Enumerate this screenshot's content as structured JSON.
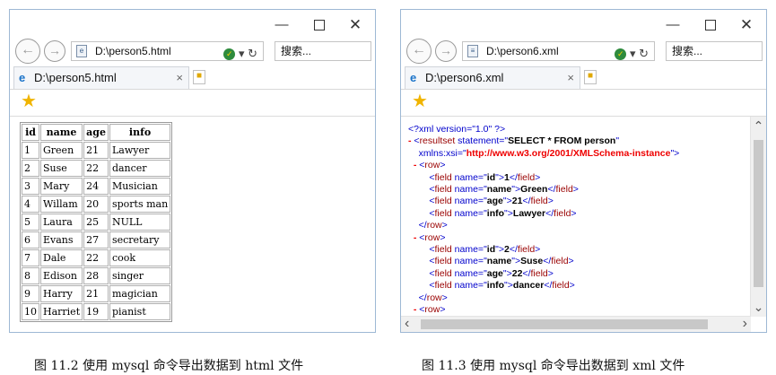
{
  "window1": {
    "address": "D:\\person5.html",
    "search": "搜索...",
    "tab_title": "D:\\person5.html",
    "table": {
      "headers": [
        "id",
        "name",
        "age",
        "info"
      ],
      "rows": [
        [
          "1",
          "Green",
          "21",
          "Lawyer"
        ],
        [
          "2",
          "Suse",
          "22",
          "dancer"
        ],
        [
          "3",
          "Mary",
          "24",
          "Musician"
        ],
        [
          "4",
          "Willam",
          "20",
          "sports man"
        ],
        [
          "5",
          "Laura",
          "25",
          "NULL"
        ],
        [
          "6",
          "Evans",
          "27",
          "secretary"
        ],
        [
          "7",
          "Dale",
          "22",
          "cook"
        ],
        [
          "8",
          "Edison",
          "28",
          "singer"
        ],
        [
          "9",
          "Harry",
          "21",
          "magician"
        ],
        [
          "10",
          "Harriet",
          "19",
          "pianist"
        ]
      ]
    }
  },
  "window2": {
    "address": "D:\\person6.xml",
    "search": "搜索...",
    "tab_title": "D:\\person6.xml",
    "xml_lines": [
      [
        {
          "t": "pl",
          "v": "<?xml version=\"1.0\" ?>"
        }
      ],
      [
        {
          "t": "mk",
          "v": "- "
        },
        {
          "t": "pl",
          "v": "<"
        },
        {
          "t": "tg",
          "v": "resultset"
        },
        {
          "t": "pl",
          "v": " statement=\""
        },
        {
          "t": "tx",
          "v": "SELECT * FROM person"
        },
        {
          "t": "pl",
          "v": "\""
        }
      ],
      [
        {
          "t": "pl",
          "v": "    xmlns:xsi=\""
        },
        {
          "t": "mk",
          "v": "http://www.w3.org/2001/XMLSchema-instance"
        },
        {
          "t": "pl",
          "v": "\">"
        }
      ],
      [
        {
          "t": "mk",
          "v": "  - "
        },
        {
          "t": "pl",
          "v": "<"
        },
        {
          "t": "tg",
          "v": "row"
        },
        {
          "t": "pl",
          "v": ">"
        }
      ],
      [
        {
          "t": "pl",
          "v": "        <"
        },
        {
          "t": "tg",
          "v": "field"
        },
        {
          "t": "pl",
          "v": " name=\""
        },
        {
          "t": "tx",
          "v": "id"
        },
        {
          "t": "pl",
          "v": "\">"
        },
        {
          "t": "tx",
          "v": "1"
        },
        {
          "t": "pl",
          "v": "</"
        },
        {
          "t": "tg",
          "v": "field"
        },
        {
          "t": "pl",
          "v": ">"
        }
      ],
      [
        {
          "t": "pl",
          "v": "        <"
        },
        {
          "t": "tg",
          "v": "field"
        },
        {
          "t": "pl",
          "v": " name=\""
        },
        {
          "t": "tx",
          "v": "name"
        },
        {
          "t": "pl",
          "v": "\">"
        },
        {
          "t": "tx",
          "v": "Green"
        },
        {
          "t": "pl",
          "v": "</"
        },
        {
          "t": "tg",
          "v": "field"
        },
        {
          "t": "pl",
          "v": ">"
        }
      ],
      [
        {
          "t": "pl",
          "v": "        <"
        },
        {
          "t": "tg",
          "v": "field"
        },
        {
          "t": "pl",
          "v": " name=\""
        },
        {
          "t": "tx",
          "v": "age"
        },
        {
          "t": "pl",
          "v": "\">"
        },
        {
          "t": "tx",
          "v": "21"
        },
        {
          "t": "pl",
          "v": "</"
        },
        {
          "t": "tg",
          "v": "field"
        },
        {
          "t": "pl",
          "v": ">"
        }
      ],
      [
        {
          "t": "pl",
          "v": "        <"
        },
        {
          "t": "tg",
          "v": "field"
        },
        {
          "t": "pl",
          "v": " name=\""
        },
        {
          "t": "tx",
          "v": "info"
        },
        {
          "t": "pl",
          "v": "\">"
        },
        {
          "t": "tx",
          "v": "Lawyer"
        },
        {
          "t": "pl",
          "v": "</"
        },
        {
          "t": "tg",
          "v": "field"
        },
        {
          "t": "pl",
          "v": ">"
        }
      ],
      [
        {
          "t": "pl",
          "v": "    </"
        },
        {
          "t": "tg",
          "v": "row"
        },
        {
          "t": "pl",
          "v": ">"
        }
      ],
      [
        {
          "t": "mk",
          "v": "  - "
        },
        {
          "t": "pl",
          "v": "<"
        },
        {
          "t": "tg",
          "v": "row"
        },
        {
          "t": "pl",
          "v": ">"
        }
      ],
      [
        {
          "t": "pl",
          "v": "        <"
        },
        {
          "t": "tg",
          "v": "field"
        },
        {
          "t": "pl",
          "v": " name=\""
        },
        {
          "t": "tx",
          "v": "id"
        },
        {
          "t": "pl",
          "v": "\">"
        },
        {
          "t": "tx",
          "v": "2"
        },
        {
          "t": "pl",
          "v": "</"
        },
        {
          "t": "tg",
          "v": "field"
        },
        {
          "t": "pl",
          "v": ">"
        }
      ],
      [
        {
          "t": "pl",
          "v": "        <"
        },
        {
          "t": "tg",
          "v": "field"
        },
        {
          "t": "pl",
          "v": " name=\""
        },
        {
          "t": "tx",
          "v": "name"
        },
        {
          "t": "pl",
          "v": "\">"
        },
        {
          "t": "tx",
          "v": "Suse"
        },
        {
          "t": "pl",
          "v": "</"
        },
        {
          "t": "tg",
          "v": "field"
        },
        {
          "t": "pl",
          "v": ">"
        }
      ],
      [
        {
          "t": "pl",
          "v": "        <"
        },
        {
          "t": "tg",
          "v": "field"
        },
        {
          "t": "pl",
          "v": " name=\""
        },
        {
          "t": "tx",
          "v": "age"
        },
        {
          "t": "pl",
          "v": "\">"
        },
        {
          "t": "tx",
          "v": "22"
        },
        {
          "t": "pl",
          "v": "</"
        },
        {
          "t": "tg",
          "v": "field"
        },
        {
          "t": "pl",
          "v": ">"
        }
      ],
      [
        {
          "t": "pl",
          "v": "        <"
        },
        {
          "t": "tg",
          "v": "field"
        },
        {
          "t": "pl",
          "v": " name=\""
        },
        {
          "t": "tx",
          "v": "info"
        },
        {
          "t": "pl",
          "v": "\">"
        },
        {
          "t": "tx",
          "v": "dancer"
        },
        {
          "t": "pl",
          "v": "</"
        },
        {
          "t": "tg",
          "v": "field"
        },
        {
          "t": "pl",
          "v": ">"
        }
      ],
      [
        {
          "t": "pl",
          "v": "    </"
        },
        {
          "t": "tg",
          "v": "row"
        },
        {
          "t": "pl",
          "v": ">"
        }
      ],
      [
        {
          "t": "mk",
          "v": "  - "
        },
        {
          "t": "pl",
          "v": "<"
        },
        {
          "t": "tg",
          "v": "row"
        },
        {
          "t": "pl",
          "v": ">"
        }
      ]
    ]
  },
  "captions": {
    "left": "图 11.2   使用 mysql 命令导出数据到 html 文件",
    "right": "图 11.3   使用 mysql 命令导出数据到 xml 文件"
  },
  "colors": {
    "xml_markup": "#ee0000",
    "xml_tag": "#990000",
    "xml_punct": "#0000cc",
    "window_border": "#9eb8d4"
  },
  "icons": [
    "minimize-icon",
    "maximize-icon",
    "close-icon",
    "back-icon",
    "forward-icon",
    "page-icon",
    "compat-icon",
    "refresh-icon",
    "ie-icon",
    "tab-close-icon",
    "new-tab-icon",
    "favorites-star-icon",
    "scroll-up-icon",
    "scroll-down-icon",
    "scroll-left-icon",
    "scroll-right-icon"
  ]
}
